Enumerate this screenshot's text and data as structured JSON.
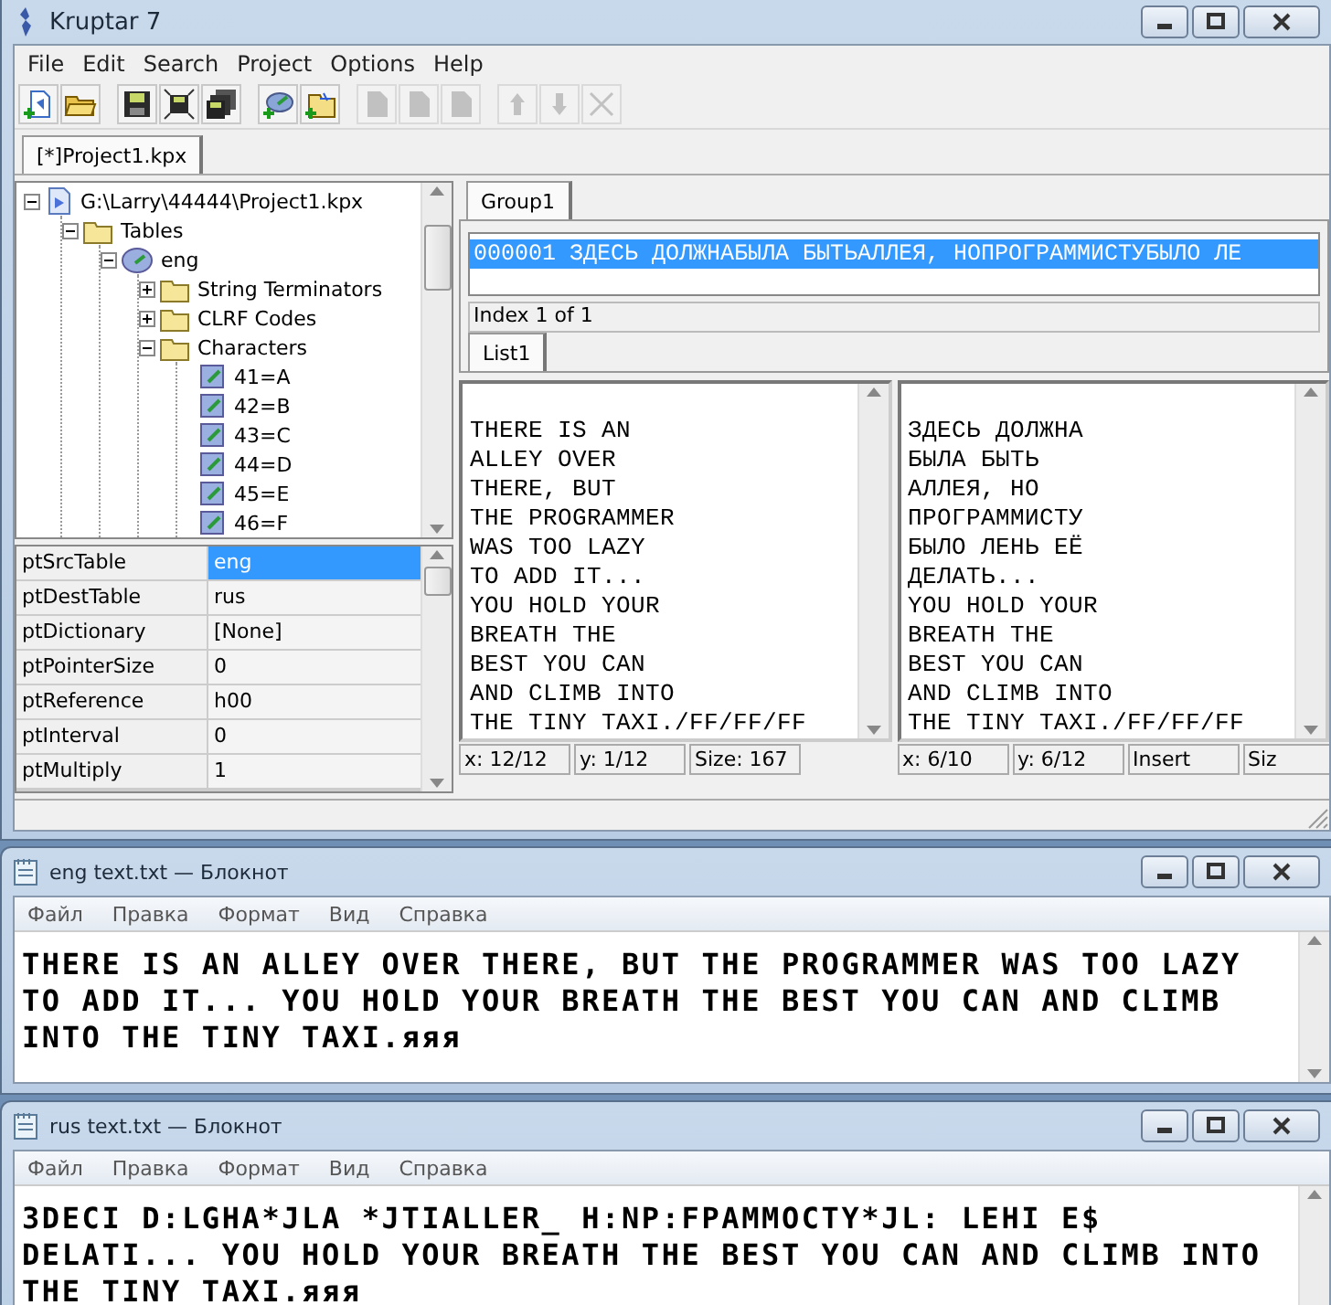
{
  "main_window": {
    "title": "Kruptar 7",
    "menu": [
      "File",
      "Edit",
      "Search",
      "Project",
      "Options",
      "Help"
    ],
    "toolbar": [
      {
        "kind": "new",
        "disabled": false
      },
      {
        "kind": "open",
        "disabled": false
      },
      {
        "kind": "save",
        "disabled": false
      },
      {
        "kind": "save-flash",
        "disabled": false
      },
      {
        "kind": "save-all",
        "disabled": false
      },
      {
        "kind": "add-table",
        "disabled": false
      },
      {
        "kind": "add-folder",
        "disabled": false
      },
      {
        "kind": "page",
        "disabled": true
      },
      {
        "kind": "page",
        "disabled": true
      },
      {
        "kind": "page",
        "disabled": true
      },
      {
        "kind": "up",
        "disabled": true
      },
      {
        "kind": "down",
        "disabled": true
      },
      {
        "kind": "delete",
        "disabled": true
      }
    ],
    "document_tabs": [
      {
        "label": "[*]Project1.kpx",
        "selected": true
      }
    ],
    "tree": [
      {
        "label": "G:\\Larry\\44444\\Project1.kpx",
        "kind": "project",
        "expanded": true,
        "children": [
          {
            "label": "Tables",
            "kind": "folder",
            "expanded": true,
            "children": [
              {
                "label": "eng",
                "kind": "table",
                "expanded": true,
                "children": [
                  {
                    "label": "String Terminators",
                    "kind": "folder",
                    "expanded": false
                  },
                  {
                    "label": "CLRF Codes",
                    "kind": "folder",
                    "expanded": false
                  },
                  {
                    "label": "Characters",
                    "kind": "folder",
                    "expanded": true,
                    "children": [
                      {
                        "label": "41=A",
                        "kind": "char"
                      },
                      {
                        "label": "42=B",
                        "kind": "char"
                      },
                      {
                        "label": "43=C",
                        "kind": "char"
                      },
                      {
                        "label": "44=D",
                        "kind": "char"
                      },
                      {
                        "label": "45=E",
                        "kind": "char"
                      },
                      {
                        "label": "46=F",
                        "kind": "char"
                      }
                    ]
                  }
                ]
              }
            ]
          }
        ]
      }
    ],
    "properties": [
      {
        "name": "ptSrcTable",
        "value": "eng",
        "selected": true
      },
      {
        "name": "ptDestTable",
        "value": "rus",
        "selected": false
      },
      {
        "name": "ptDictionary",
        "value": "[None]",
        "selected": false
      },
      {
        "name": "ptPointerSize",
        "value": "0",
        "selected": false
      },
      {
        "name": "ptReference",
        "value": "h00",
        "selected": false
      },
      {
        "name": "ptInterval",
        "value": "0",
        "selected": false
      },
      {
        "name": "ptMultiply",
        "value": "1",
        "selected": false
      }
    ],
    "group_tabs": [
      {
        "label": "Group1",
        "selected": true
      }
    ],
    "string_list": [
      {
        "text": "000001 ЗДЕСЬ ДОЛЖНАБЫЛА БЫТЬАЛЛЕЯ, НОПРОГРАММИСТУБЫЛО ЛЕ",
        "selected": true
      }
    ],
    "index_label": "Index 1 of 1",
    "list_tabs": [
      {
        "label": "List1",
        "selected": true
      }
    ],
    "editors": [
      {
        "lines": [
          "THERE IS AN",
          "ALLEY OVER",
          "THERE, BUT",
          "THE PROGRAMMER",
          "WAS TOO LAZY",
          "TO ADD IT...",
          "YOU HOLD YOUR",
          "BREATH THE",
          "BEST YOU CAN",
          "AND CLIMB INTO",
          "THE TINY TAXI./FF/FF/FF"
        ],
        "status": [
          "x: 12/12",
          "y: 1/12",
          "Size: 167"
        ]
      },
      {
        "lines": [
          "ЗДЕСЬ ДОЛЖНА",
          "БЫЛА БЫТЬ",
          "АЛЛЕЯ, НО",
          "ПРОГРАММИСТУ",
          "БЫЛО ЛЕНЬ ЕЁ",
          "ДЕЛАТЬ...",
          "YOU HOLD YOUR",
          "BREATH THE",
          "BEST YOU CAN",
          "AND CLIMB INTO",
          "THE TINY TAXI./FF/FF/FF"
        ],
        "status": [
          "x: 6/10",
          "y: 6/12",
          "Insert",
          "Siz"
        ]
      }
    ]
  },
  "notepads": [
    {
      "title": "eng text.txt — Блокнот",
      "menu": [
        "Файл",
        "Правка",
        "Формат",
        "Вид",
        "Справка"
      ],
      "lines": [
        "THERE IS AN ALLEY OVER THERE, BUT THE PROGRAMMER WAS TOO LAZY",
        "TO ADD IT... YOU HOLD YOUR BREATH THE BEST YOU CAN AND CLIMB",
        "INTO THE TINY TAXI.яяя"
      ]
    },
    {
      "title": "rus text.txt — Блокнот",
      "menu": [
        "Файл",
        "Правка",
        "Формат",
        "Вид",
        "Справка"
      ],
      "lines": [
        "3DECI D:LGHA*JLA *JTIALLER_ H:NP:FPAMMOCTY*JL: LEHI E$",
        "DELATI... YOU HOLD YOUR BREATH THE BEST YOU CAN AND CLIMB INTO",
        "THE TINY TAXI.яяя"
      ]
    }
  ]
}
